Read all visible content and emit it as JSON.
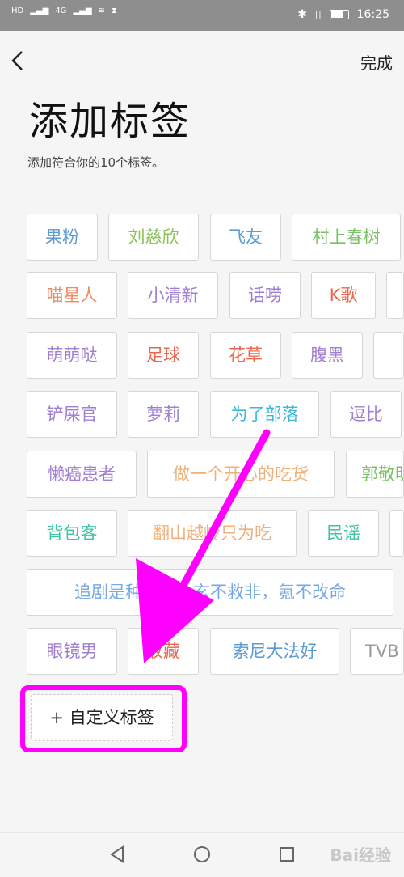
{
  "status_bar": {
    "left_indicators": [
      "HD",
      "4G",
      "4G"
    ],
    "time": "16:25"
  },
  "header": {
    "back_icon": "chevron-left-icon",
    "done_label": "完成"
  },
  "title": "添加标签",
  "subtitle": "添加符合你的10个标签。",
  "tags": [
    {
      "label": "果粉",
      "color": "#5b9bd5"
    },
    {
      "label": "刘慈欣",
      "color": "#8ac057"
    },
    {
      "label": "飞友",
      "color": "#5b9bd5"
    },
    {
      "label": "村上春树",
      "color": "#7cc067"
    },
    {
      "label": "喵星人",
      "color": "#ef8a62"
    },
    {
      "label": "小清新",
      "color": "#a07fd0"
    },
    {
      "label": "话唠",
      "color": "#a07fd0"
    },
    {
      "label": "K歌",
      "color": "#e8674f"
    },
    {
      "label": "萌萌哒",
      "color": "#a07fd0"
    },
    {
      "label": "足球",
      "color": "#e8674f"
    },
    {
      "label": "花草",
      "color": "#e8674f"
    },
    {
      "label": "腹黑",
      "color": "#a07fd0"
    },
    {
      "label": "铲屎官",
      "color": "#a07fd0"
    },
    {
      "label": "萝莉",
      "color": "#a07fd0"
    },
    {
      "label": "为了部落",
      "color": "#3fb8d8"
    },
    {
      "label": "逗比",
      "color": "#a07fd0"
    },
    {
      "label": "懒癌患者",
      "color": "#a07fd0"
    },
    {
      "label": "做一个开心的吃货",
      "color": "#f0b07a"
    },
    {
      "label": "郭敬明",
      "color": "#7cc067"
    },
    {
      "label": "背包客",
      "color": "#3ec4a4"
    },
    {
      "label": "翻山越岭只为吃",
      "color": "#f0b07a"
    },
    {
      "label": "民谣",
      "color": "#3ec4a4"
    },
    {
      "label": "追剧是种坚持，玄不救非，氪不改命",
      "color": "#73a9e6"
    },
    {
      "label": "眼镜男",
      "color": "#a07fd0"
    },
    {
      "label": "收藏",
      "color": "#e8674f"
    },
    {
      "label": "索尼大法好",
      "color": "#5b9bd5"
    },
    {
      "label": "TVB",
      "color": "#9a9a9a"
    }
  ],
  "custom_button_label": "+ 自定义标签",
  "annotation": {
    "color": "#ff00ff"
  },
  "nav_bar": {
    "back_icon": "triangle-back-icon",
    "home_icon": "circle-home-icon",
    "recent_icon": "square-recent-icon"
  },
  "watermark_text": "Bai经验"
}
